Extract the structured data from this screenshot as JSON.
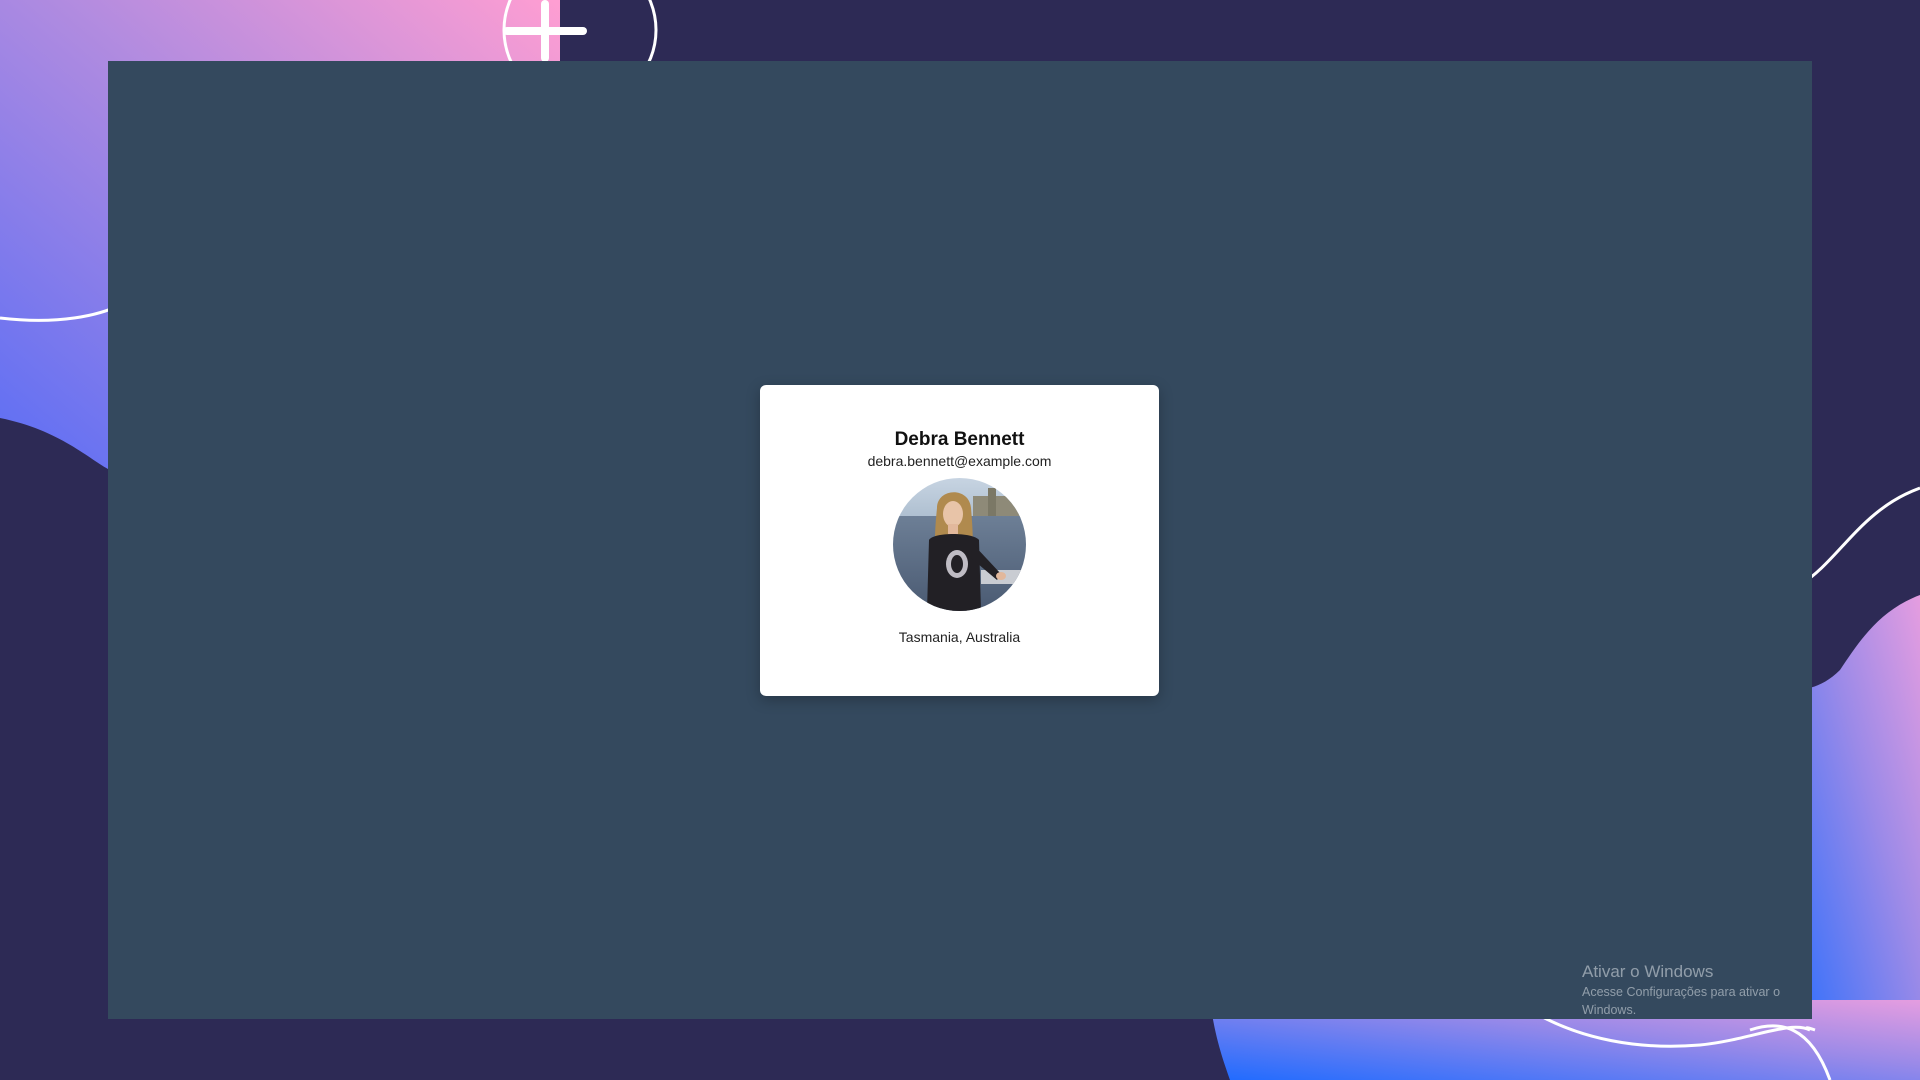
{
  "profile": {
    "name": "Debra Bennett",
    "email": "debra.bennett@example.com",
    "location": "Tasmania, Australia",
    "avatar_icon": "profile-photo"
  },
  "watermark": {
    "title": "Ativar o Windows",
    "subtitle": "Acesse Configurações para ativar o Windows."
  },
  "colors": {
    "desktop_background": "#2d2a55",
    "page_background": "#34495e",
    "card_background": "#ffffff",
    "gradient_pink": "#ff9ed2",
    "gradient_blue": "#1f6bff"
  }
}
